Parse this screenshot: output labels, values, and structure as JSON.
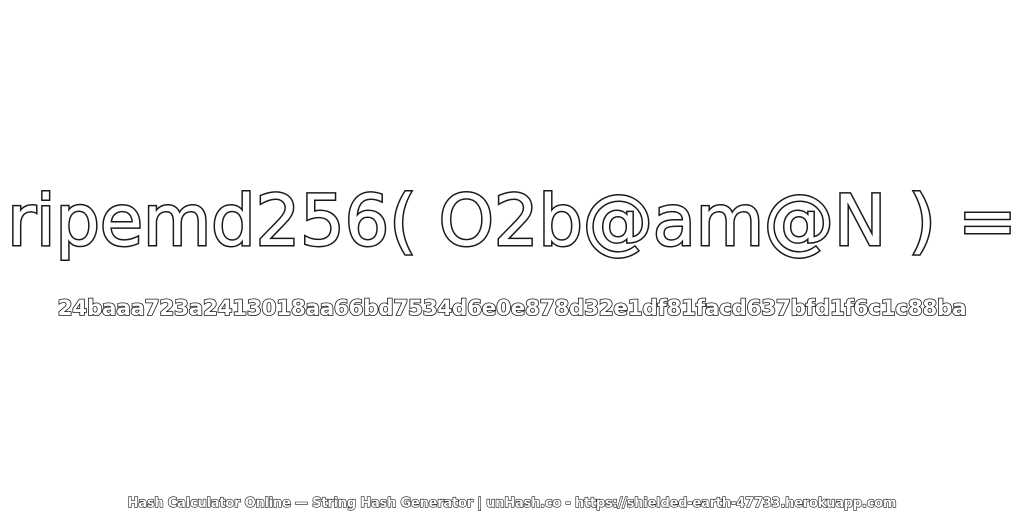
{
  "headline": "ripemd256( O2b@am@N ) =",
  "hash_value": "24baaa723a2413018aa66bd7534d6e0e878d32e1df81facd637bfd1f6c1c88ba",
  "footer": "Hash Calculator Online — String Hash Generator | unHash.co - https://shielded-earth-47733.herokuapp.com",
  "colors": {
    "background": "#ffffff",
    "outline": "#1a1a1a",
    "fill": "#ffffff"
  }
}
